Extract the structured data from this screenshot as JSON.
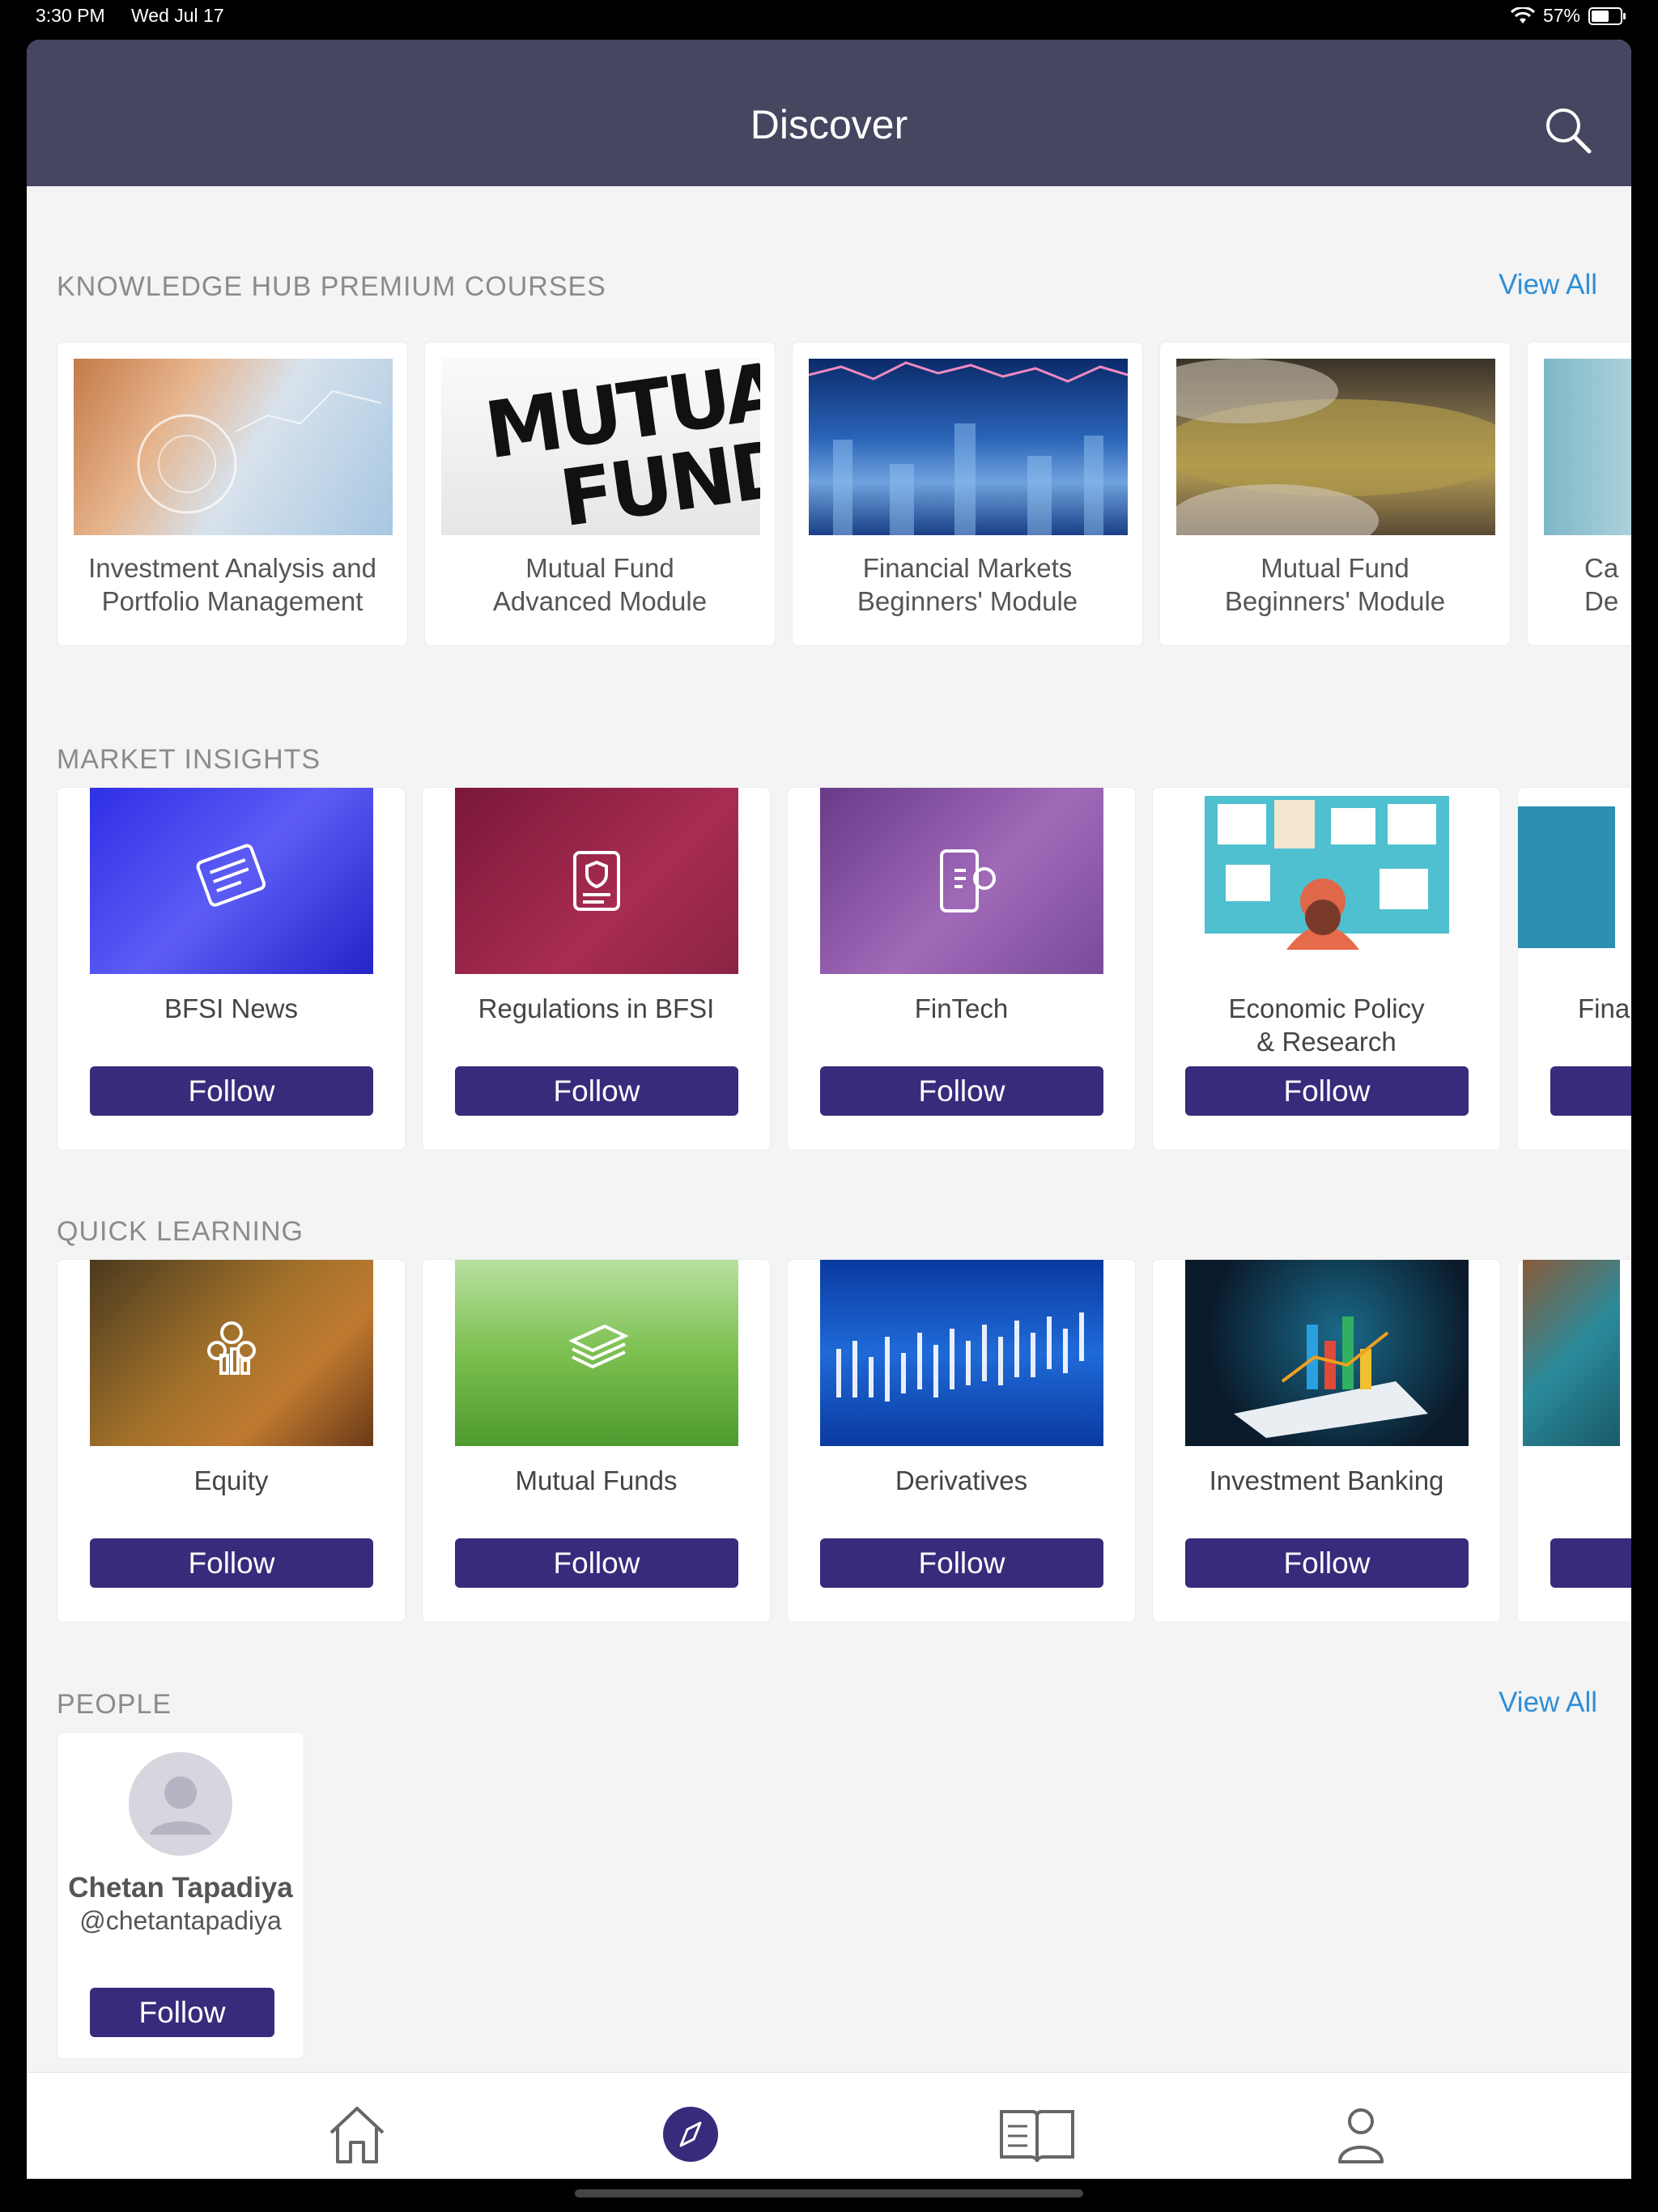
{
  "status": {
    "time": "3:30 PM",
    "date": "Wed Jul 17",
    "battery": "57%"
  },
  "header": {
    "title": "Discover"
  },
  "courses": {
    "title": "KNOWLEDGE HUB PREMIUM COURSES",
    "view_all": "View All",
    "items": [
      {
        "line1": "Investment Analysis and",
        "line2": "Portfolio Management"
      },
      {
        "line1": "Mutual Fund",
        "line2": "Advanced Module"
      },
      {
        "line1": "Financial Markets",
        "line2": "Beginners' Module"
      },
      {
        "line1": "Mutual Fund",
        "line2": "Beginners' Module"
      },
      {
        "line1": "Ca",
        "line2": "De"
      }
    ],
    "thumb_text": {
      "mutual": "MUTUAL",
      "fund": "FUND"
    }
  },
  "market_insights": {
    "title": "MARKET INSIGHTS",
    "items": [
      {
        "line1": "BFSI News",
        "line2": "",
        "follow": "Follow"
      },
      {
        "line1": "Regulations in BFSI",
        "line2": "",
        "follow": "Follow"
      },
      {
        "line1": "FinTech",
        "line2": "",
        "follow": "Follow"
      },
      {
        "line1": "Economic Policy",
        "line2": "& Research",
        "follow": "Follow"
      },
      {
        "line1": "Fina",
        "line2": "",
        "follow": ""
      }
    ]
  },
  "quick_learning": {
    "title": "QUICK LEARNING",
    "items": [
      {
        "line1": "Equity",
        "follow": "Follow"
      },
      {
        "line1": "Mutual Funds",
        "follow": "Follow"
      },
      {
        "line1": "Derivatives",
        "follow": "Follow"
      },
      {
        "line1": "Investment Banking",
        "follow": "Follow"
      },
      {
        "line1": "",
        "follow": ""
      }
    ]
  },
  "people": {
    "title": "PEOPLE",
    "view_all": "View All",
    "items": [
      {
        "name": "Chetan Tapadiya",
        "handle": "@chetantapadiya",
        "follow": "Follow"
      }
    ]
  },
  "tabs": [
    "home-icon",
    "compass-icon",
    "book-icon",
    "profile-icon"
  ],
  "colors": {
    "nav": "#464660",
    "button": "#372b7b",
    "link": "#2f8fd6"
  }
}
